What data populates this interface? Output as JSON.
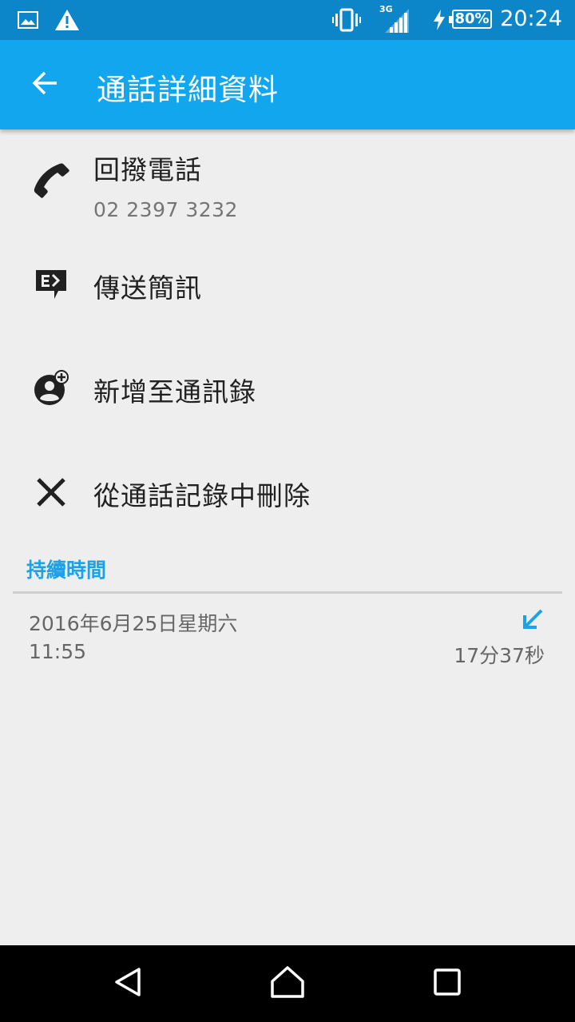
{
  "status_bar": {
    "time": "20:24",
    "battery": "80%",
    "network": "3G",
    "icons": [
      "image-icon",
      "warning-icon",
      "vibrate-icon",
      "signal-icon",
      "charging-icon",
      "battery-icon"
    ]
  },
  "app_bar": {
    "title": "通話詳細資料",
    "back_icon": "arrow-back-icon"
  },
  "actions": [
    {
      "label": "回撥電話",
      "sublabel": "02 2397 3232",
      "icon": "phone-icon"
    },
    {
      "label": "傳送簡訊",
      "icon": "message-icon"
    },
    {
      "label": "新增至通訊錄",
      "icon": "add-contact-icon"
    },
    {
      "label": "從通話記錄中刪除",
      "icon": "close-icon"
    }
  ],
  "call_log": {
    "section_title": "持續時間",
    "entries": [
      {
        "date": "2016年6月25日星期六",
        "time": "11:55",
        "duration": "17分37秒",
        "type_icon": "incoming-call-icon"
      }
    ]
  },
  "nav_bar": {
    "buttons": [
      "back-nav-icon",
      "home-nav-icon",
      "recents-nav-icon"
    ]
  },
  "colors": {
    "status_bar": "#0d86c9",
    "app_bar": "#12a6ee",
    "accent": "#1aa3e8",
    "background": "#eeeeee"
  }
}
